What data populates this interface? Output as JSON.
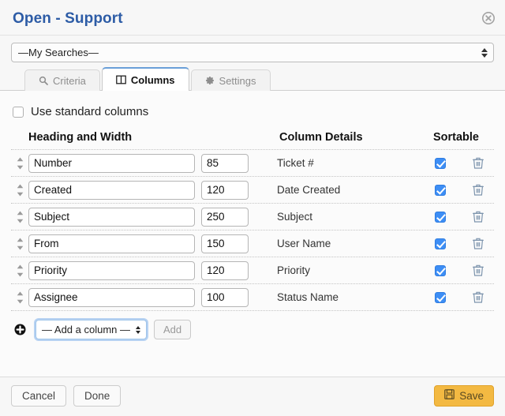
{
  "header": {
    "title": "Open - Support",
    "close_icon": "close-circle-icon"
  },
  "saved_search": {
    "selected": "—My Searches—"
  },
  "tabs": [
    {
      "label": "Criteria",
      "icon": "search-icon",
      "active": false
    },
    {
      "label": "Columns",
      "icon": "columns-icon",
      "active": true
    },
    {
      "label": "Settings",
      "icon": "gear-icon",
      "active": false
    }
  ],
  "standard_columns": {
    "label": "Use standard columns",
    "checked": false
  },
  "table": {
    "headers": {
      "heading_width": "Heading and Width",
      "column_details": "Column Details",
      "sortable": "Sortable"
    },
    "rows": [
      {
        "heading": "Number",
        "width": "85",
        "details": "Ticket #",
        "sortable": true
      },
      {
        "heading": "Created",
        "width": "120",
        "details": "Date Created",
        "sortable": true
      },
      {
        "heading": "Subject",
        "width": "250",
        "details": "Subject",
        "sortable": true
      },
      {
        "heading": "From",
        "width": "150",
        "details": "User Name",
        "sortable": true
      },
      {
        "heading": "Priority",
        "width": "120",
        "details": "Priority",
        "sortable": true
      },
      {
        "heading": "Assignee",
        "width": "100",
        "details": "Status Name",
        "sortable": true
      }
    ]
  },
  "add_column": {
    "plus_icon": "plus-circle-icon",
    "select_value": "— Add a column —",
    "add_button": "Add"
  },
  "footer": {
    "cancel": "Cancel",
    "done": "Done",
    "save": "Save",
    "save_icon": "floppy-save-icon"
  },
  "colors": {
    "title": "#2d5ca6",
    "accent_blue": "#6a9fd8",
    "checkbox_blue": "#3d8ef5",
    "save_amber": "#f3b942",
    "trash_blue_gray": "#7d94ad"
  }
}
